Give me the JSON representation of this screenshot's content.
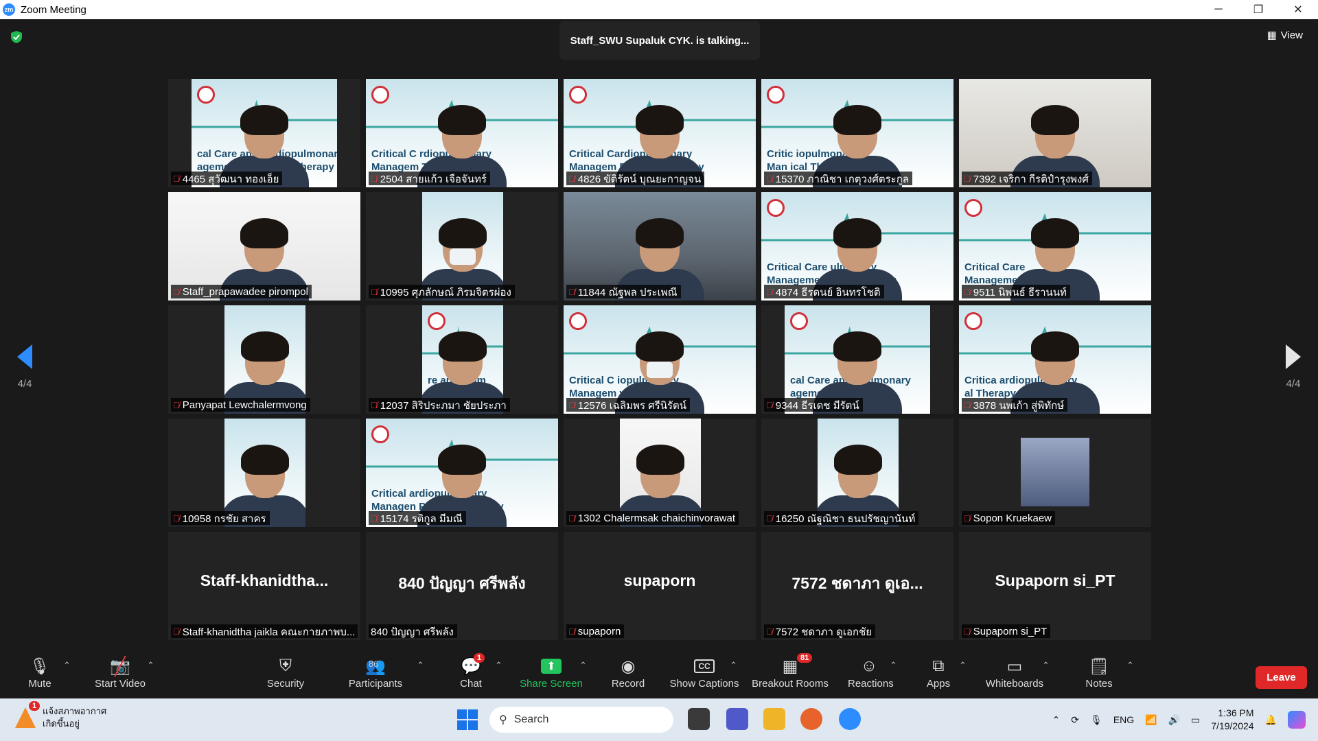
{
  "window": {
    "title": "Zoom Meeting",
    "controls": [
      "─",
      "❐",
      "✕"
    ]
  },
  "meeting": {
    "talking": "Staff_SWU Supaluk CYK. is talking...",
    "view_label": "View",
    "page_indicator": "4/4"
  },
  "slide": {
    "line1": "Critical Care and Cardiopulmonary",
    "line2": "Management for Physical Therapy"
  },
  "tiles": [
    {
      "name": "4465 สุวัฒนา ทองเอ็ย",
      "slide": "cal Care and C  rdiopulmonary|agement for P  sical Therapy",
      "video": "narrow"
    },
    {
      "name": "2504 สายแก้ว เจือจันทร์",
      "slide": "Critical C   rdiopulmonary|Managem       Therapy",
      "video": "full"
    },
    {
      "name": "4826 ขัติรัตน์ บุณยะกาญจน",
      "slide": "Critical    Cardiopulmonary|Managem   Physical Therapy",
      "video": "full"
    },
    {
      "name": "15370 ภาณิชา เกตุวงศ์ตระกูล",
      "slide": "Critic       iopulmonary|Man         ical Therapy",
      "video": "full"
    },
    {
      "name": "7392 เจริกา กีรติปำรุงพงศ์",
      "slide": "",
      "video": "plain"
    },
    {
      "name": "Staff_prapawadee  pirompol",
      "slide": "",
      "video": "white"
    },
    {
      "name": "10995 ศุภลักษณ์ ภิรมจิตรผ่อง",
      "slide": "",
      "video": "narrow2"
    },
    {
      "name": "11844 ณัฐพล ประเพณี",
      "slide": "",
      "video": "room"
    },
    {
      "name": "4874 ธีรดนย์ อินทรโชติ",
      "slide": "Critical Care      ulmonary|Management f       cal Therapy",
      "video": "full"
    },
    {
      "name": "9511 นิพนธ์ ธีรานนท์",
      "slide": "Critical Care|Manageme",
      "video": "full"
    },
    {
      "name": "Panyapat Lewchalermvong",
      "slide": "",
      "video": "narrow2"
    },
    {
      "name": "12037 สิริประภมา ชัยประภา",
      "slide": "re and   pulm|nt for   al Th",
      "video": "narrow2"
    },
    {
      "name": "12576 เฉลิมพร ศรีนิรัตน์",
      "slide": "Critical C      iopulmonary|Managem    ysical Therapy",
      "video": "full"
    },
    {
      "name": "9344 ธีรเดช มีรัตน์",
      "slide": "cal Care and C   ulmonary|agement for       Therapy",
      "video": "narrow"
    },
    {
      "name": "3878 นพเก้า สู่พิทักษ์",
      "slide": "Critica    ardiopulmonary|          al Therapy",
      "video": "full"
    },
    {
      "name": "10958 กรชัย สาคร",
      "slide": "",
      "video": "narrow2"
    },
    {
      "name": "15174 รติกูล มีมณี",
      "slide": "Critical      ardiopulmonary|Managen    Physical Therapy",
      "video": "full"
    },
    {
      "name": "1302 Chalermsak chaichinvorawat",
      "slide": "",
      "video": "narrow2w"
    },
    {
      "name": "16250 ณัฐณิชา ธนปรัชญานันท์",
      "slide": "",
      "video": "narrow2"
    },
    {
      "name": "Sopon Kruekaew",
      "slide": "",
      "video": "photo"
    }
  ],
  "name_tiles": [
    {
      "big": "Staff-khanidtha...",
      "label": "Staff-khanidtha jaikla คณะกายภาพบ...",
      "muted": true
    },
    {
      "big": "840 ปัญญา ศรีพลัง",
      "label": "840 ปัญญา ศรีพลัง",
      "muted": false
    },
    {
      "big": "supaporn",
      "label": "supaporn",
      "muted": true
    },
    {
      "big": "7572 ชดาภา ดูเอ...",
      "label": "7572 ชดาภา ดูเอกชัย",
      "muted": true
    },
    {
      "big": "Supaporn si_PT",
      "label": "Supaporn si_PT",
      "muted": true
    }
  ],
  "toolbar": {
    "mute": "Mute",
    "start_video": "Start Video",
    "security": "Security",
    "participants": "Participants",
    "participants_count": "86",
    "chat": "Chat",
    "chat_badge": "1",
    "share": "Share Screen",
    "record": "Record",
    "captions": "Show Captions",
    "breakout": "Breakout Rooms",
    "breakout_badge": "81",
    "reactions": "Reactions",
    "apps": "Apps",
    "whiteboards": "Whiteboards",
    "notes": "Notes",
    "leave": "Leave"
  },
  "taskbar": {
    "weather_line1": "แจ้งสภาพอากาศ",
    "weather_line2": "เกิดขึ้นอยู่",
    "weather_badge": "1",
    "search_placeholder": "Search",
    "lang": "ENG",
    "time": "1:36 PM",
    "date": "7/19/2024"
  },
  "colors": {
    "accent": "#2d8cff",
    "leave": "#e02828",
    "muted_icon": "#e0393e",
    "share": "#22c55e"
  }
}
